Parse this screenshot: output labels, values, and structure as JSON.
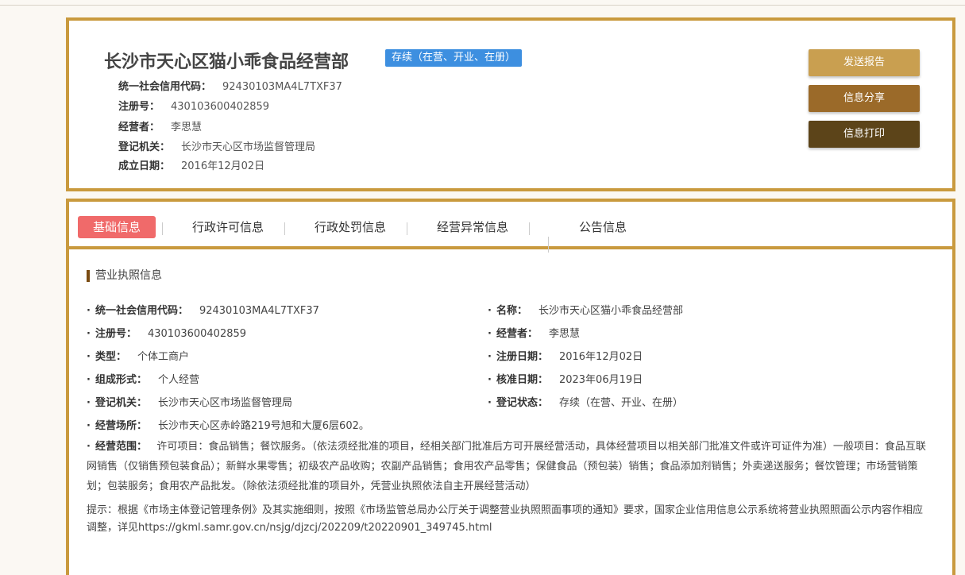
{
  "header": {
    "company_name": "长沙市天心区猫小乖食品经营部",
    "status": "存续（在营、开业、在册）",
    "rows": [
      {
        "label": "统一社会信用代码：",
        "value": "92430103MA4L7TXF37"
      },
      {
        "label": "注册号：",
        "value": "430103600402859"
      },
      {
        "label": "经营者：",
        "value": "李思慧"
      },
      {
        "label": "登记机关：",
        "value": "长沙市天心区市场监督管理局"
      },
      {
        "label": "成立日期：",
        "value": "2016年12月02日"
      }
    ],
    "buttons": {
      "report": "发送报告",
      "share": "信息分享",
      "print": "信息打印"
    }
  },
  "tabs": [
    {
      "label": "基础信息"
    },
    {
      "label": "行政许可信息"
    },
    {
      "label": "行政处罚信息"
    },
    {
      "label": "经营异常信息"
    },
    {
      "label": "公告信息"
    }
  ],
  "section_title": "营业执照信息",
  "fields": {
    "credit_code": {
      "label": "统一社会信用代码：",
      "value": "92430103MA4L7TXF37"
    },
    "name": {
      "label": "名称：",
      "value": "长沙市天心区猫小乖食品经营部"
    },
    "reg_no": {
      "label": "注册号：",
      "value": "430103600402859"
    },
    "operator": {
      "label": "经营者：",
      "value": "李思慧"
    },
    "type": {
      "label": "类型：",
      "value": "个体工商户"
    },
    "reg_date": {
      "label": "注册日期：",
      "value": "2016年12月02日"
    },
    "form": {
      "label": "组成形式：",
      "value": "个人经营"
    },
    "approval_date": {
      "label": "核准日期：",
      "value": "2023年06月19日"
    },
    "authority": {
      "label": "登记机关：",
      "value": "长沙市天心区市场监督管理局"
    },
    "reg_status": {
      "label": "登记状态：",
      "value": "存续（在营、开业、在册）"
    },
    "address": {
      "label": "经营场所：",
      "value": "长沙市天心区赤岭路219号旭和大厦6层602。"
    }
  },
  "scope": {
    "label": "经营范围：",
    "value": "许可项目：食品销售；餐饮服务。（依法须经批准的项目，经相关部门批准后方可开展经营活动，具体经营项目以相关部门批准文件或许可证件为准）一般项目：食品互联网销售（仅销售预包装食品）；新鲜水果零售；初级农产品收购；农副产品销售；食用农产品零售；保健食品（预包装）销售；食品添加剂销售；外卖递送服务；餐饮管理；市场营销策划；包装服务；食用农产品批发。（除依法须经批准的项目外，凭营业执照依法自主开展经营活动）"
  },
  "notice": "提示：根据《市场主体登记管理条例》及其实施细则，按照《市场监管总局办公厅关于调整营业执照照面事项的通知》要求，国家企业信用信息公示系统将营业执照照面公示内容作相应调整，详见https://gkml.samr.gov.cn/nsjg/djzcj/202209/t20220901_349745.html",
  "colors": {
    "border": "#c99a3e",
    "badge": "#3d8fe0",
    "active_tab": "#f06a6a",
    "btn_report": "#c99f50",
    "btn_share": "#9b6a29",
    "btn_print": "#5c4419"
  }
}
